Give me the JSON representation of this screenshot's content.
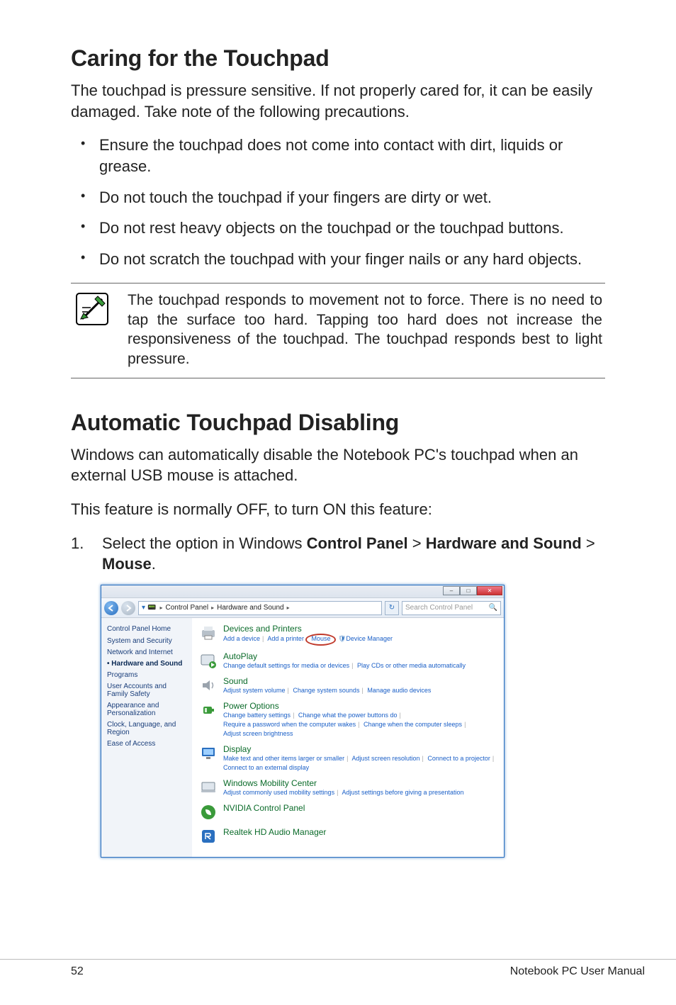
{
  "section1": {
    "title": "Caring for the Touchpad",
    "intro": "The touchpad is pressure sensitive. If not properly cared for, it can be easily damaged. Take note of the following precautions.",
    "bullets": [
      "Ensure the touchpad does not come into contact with dirt, liquids or grease.",
      "Do not touch the touchpad if your fingers are dirty or wet.",
      "Do not rest heavy objects on the touchpad or the touchpad buttons.",
      "Do not scratch the touchpad with your finger nails or any hard objects."
    ],
    "note": "The touchpad responds to movement not to force. There is no need to tap the surface too hard. Tapping too hard does not increase the responsiveness of the touchpad. The touchpad responds best to light pressure."
  },
  "section2": {
    "title": "Automatic Touchpad Disabling",
    "p1": "Windows can automatically disable the Notebook PC's touchpad when an external USB mouse is attached.",
    "p2": "This feature is normally OFF, to turn ON this feature:",
    "step_num": "1.",
    "step_pre": "Select the option in Windows ",
    "step_bold1": "Control Panel",
    "step_sep": " > ",
    "step_bold2": "Hardware and Sound",
    "step_bold3": "Mouse",
    "step_end": "."
  },
  "cp": {
    "crumb1": "Control Panel",
    "crumb2": "Hardware and Sound",
    "search_placeholder": "Search Control Panel",
    "side": {
      "home": "Control Panel Home",
      "items": [
        "System and Security",
        "Network and Internet",
        "Hardware and Sound",
        "Programs",
        "User Accounts and Family Safety",
        "Appearance and Personalization",
        "Clock, Language, and Region",
        "Ease of Access"
      ]
    },
    "cats": {
      "devices": {
        "title": "Devices and Printers",
        "l1": "Add a device",
        "l2": "Add a printer",
        "l3": "Mouse",
        "l4": "Device Manager"
      },
      "autoplay": {
        "title": "AutoPlay",
        "l1": "Change default settings for media or devices",
        "l2": "Play CDs or other media automatically"
      },
      "sound": {
        "title": "Sound",
        "l1": "Adjust system volume",
        "l2": "Change system sounds",
        "l3": "Manage audio devices"
      },
      "power": {
        "title": "Power Options",
        "l1": "Change battery settings",
        "l2": "Change what the power buttons do",
        "l3": "Require a password when the computer wakes",
        "l4": "Change when the computer sleeps",
        "l5": "Adjust screen brightness"
      },
      "display": {
        "title": "Display",
        "l1": "Make text and other items larger or smaller",
        "l2": "Adjust screen resolution",
        "l3": "Connect to a projector",
        "l4": "Connect to an external display"
      },
      "mobility": {
        "title": "Windows Mobility Center",
        "l1": "Adjust commonly used mobility settings",
        "l2": "Adjust settings before giving a presentation"
      },
      "nvidia": {
        "title": "NVIDIA Control Panel"
      },
      "realtek": {
        "title": "Realtek HD Audio Manager"
      }
    }
  },
  "footer": {
    "page": "52",
    "book": "Notebook PC User Manual"
  }
}
